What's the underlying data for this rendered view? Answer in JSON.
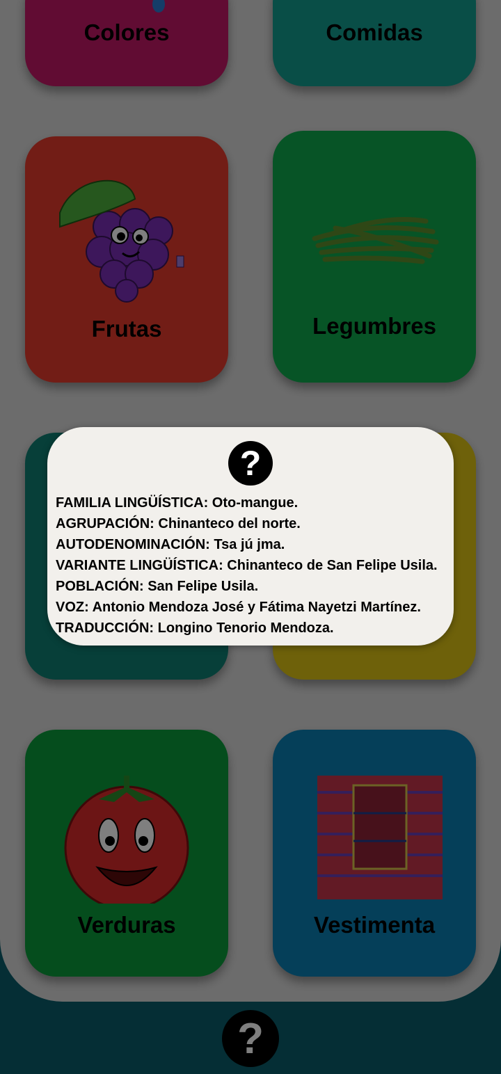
{
  "categories": [
    {
      "label": "Colores",
      "color": "#c21867"
    },
    {
      "label": "Comidas",
      "color": "#129c8e"
    },
    {
      "label": "Frutas",
      "color": "#e53a2c"
    },
    {
      "label": "Legumbres",
      "color": "#0fa84c"
    },
    {
      "label": "",
      "color": "#0e7f72"
    },
    {
      "label": "",
      "color": "#dcc315"
    },
    {
      "label": "Verduras",
      "color": "#0a9b3b"
    },
    {
      "label": "Vestimenta",
      "color": "#0a7fb3"
    }
  ],
  "dialog": {
    "icon": "question-icon",
    "lines": [
      "FAMILIA LINGÜÍSTICA: Oto-mangue.",
      "AGRUPACIÓN: Chinanteco del norte.",
      "AUTODENOMINACIÓN: Tsa jú jma.",
      "VARIANTE LINGÜÍSTICA: Chinanteco de San Felipe Usila.",
      "POBLACIÓN: San Felipe Usila.",
      "VOZ:  Antonio Mendoza José y Fátima Nayetzi Martínez.",
      "TRADUCCIÓN: Longino Tenorio Mendoza."
    ]
  },
  "help_button": {
    "icon": "question-icon",
    "glyph": "?"
  },
  "dialog_glyph": "?"
}
